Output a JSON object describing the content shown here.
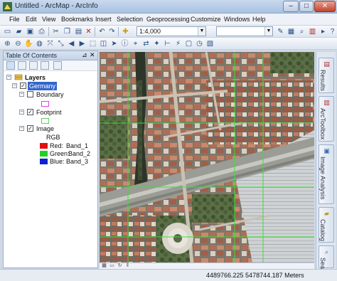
{
  "window": {
    "title": "Untitled - ArcMap - ArcInfo",
    "minimize": "–",
    "maximize": "□",
    "close": "✕"
  },
  "menu": [
    "File",
    "Edit",
    "View",
    "Bookmarks",
    "Insert",
    "Selection",
    "Geoprocessing",
    "Customize",
    "Windows",
    "Help"
  ],
  "toolbar": {
    "scale": "1:4,000",
    "icons1": [
      "new-icon",
      "open-icon",
      "save-icon",
      "print-icon",
      "cut-icon",
      "copy-icon",
      "paste-icon",
      "delete-icon",
      "undo-icon",
      "redo-icon",
      "add-data-icon"
    ],
    "icons1_right": [
      "editor-icon",
      "catalog-icon",
      "search-icon",
      "arctoolbox-icon",
      "python-icon",
      "model-icon",
      "connect-icon",
      "help-icon"
    ],
    "icons2": [
      "zoom-in-icon",
      "zoom-out-icon",
      "pan-icon",
      "full-extent-icon",
      "fixed-zoom-in-icon",
      "fixed-zoom-out-icon",
      "back-icon",
      "forward-icon",
      "select-features-icon",
      "clear-selection-icon",
      "select-element-icon",
      "identify-icon",
      "find-icon",
      "find-route-icon",
      "goto-xy-icon",
      "measure-icon",
      "hyperlink-icon",
      "html-popup-icon",
      "time-slider-icon",
      "create-viewer-icon"
    ]
  },
  "toc": {
    "title": "Table Of Contents",
    "pin": "▾ ✕",
    "layers_label": "Layers",
    "dataframe": "Germany",
    "items": [
      {
        "name": "Boundary",
        "checked": false
      },
      {
        "name": "Footprint",
        "checked": true
      },
      {
        "name": "Image",
        "checked": true
      }
    ],
    "image_legend_title": "RGB",
    "bands": [
      {
        "label": "Red:",
        "band": "Band_1",
        "color": "#e01010"
      },
      {
        "label": "Green:",
        "band": "Band_2",
        "color": "#22d022"
      },
      {
        "label": "Blue:",
        "band": "Band_3",
        "color": "#1020d0"
      }
    ],
    "boundary_color": "#e040e0",
    "footprint_color": "#7be07b"
  },
  "side_tabs": [
    "Results",
    "ArcToolbox",
    "Image Analysis",
    "Catalog",
    "Search"
  ],
  "status": {
    "coordinates": "4489766.225  5478744.187 Meters"
  }
}
